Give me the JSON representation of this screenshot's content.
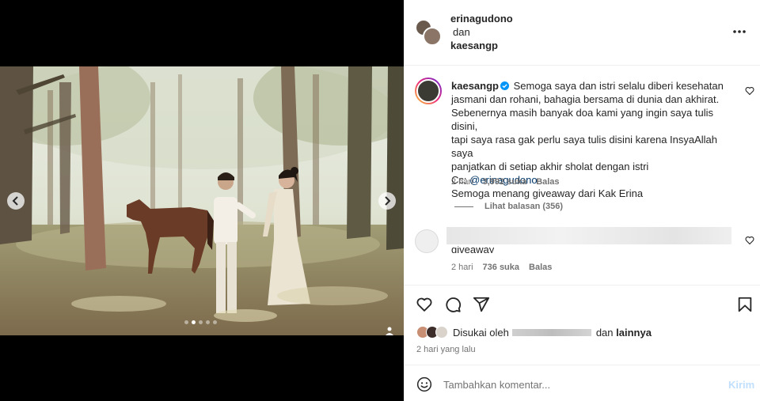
{
  "post": {
    "carousel": {
      "slide_count": 5,
      "active_slide": 2
    }
  },
  "header": {
    "user1": "erinagudono",
    "connector": "dan",
    "user2": "kaesangp"
  },
  "comments": [
    {
      "username": "kaesangp",
      "text_lines": [
        "Semoga saya dan istri selalu diberi kesehatan",
        "jasmani dan rohani, bahagia bersama di dunia dan akhirat.",
        "Sebenernya masih banyak doa kami yang ingin saya tulis disini,",
        "tapi saya rasa gak perlu saya tulis disini karena InsyaAllah saya",
        "panjatkan di setiap akhir sholat dengan istri"
      ],
      "cc_label": "Cc: ",
      "mention": "@erinagudono",
      "last_line": "Semoga menang giveaway dari Kak Erina",
      "time": "2 hari",
      "likes": "3,992 suka",
      "reply": "Balas",
      "view_replies": "Lihat balasan (356)"
    },
    {
      "partial_text": "giveaway",
      "time": "2 hari",
      "likes": "736 suka",
      "reply": "Balas"
    }
  ],
  "actions": {
    "liked_by_prefix": "Disukai oleh",
    "liked_by_suffix": "dan",
    "liked_by_others": "lainnya",
    "time_ago": "2 hari yang lalu"
  },
  "composer": {
    "placeholder": "Tambahkan komentar...",
    "post_label": "Kirim"
  },
  "icons": [
    "chevron-left-icon",
    "chevron-right-icon",
    "tag-user-icon",
    "more-icon",
    "verified-icon",
    "heart-icon",
    "comment-icon",
    "share-icon",
    "bookmark-icon",
    "emoji-icon"
  ],
  "colors": {
    "verified": "#0095f6",
    "mention": "#00376b",
    "muted": "#737373",
    "post_disabled": "#c0dffd"
  }
}
